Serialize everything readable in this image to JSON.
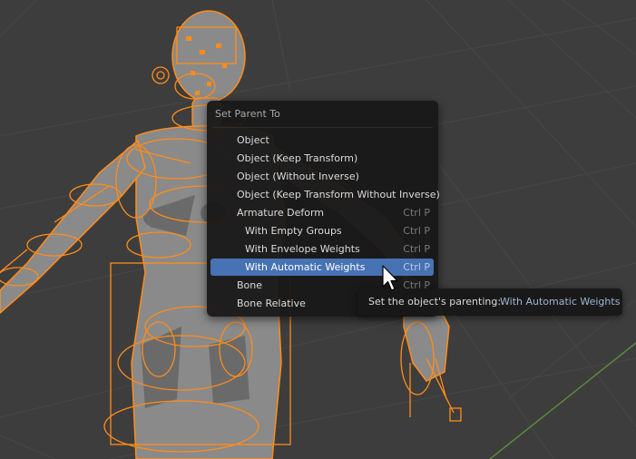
{
  "colors": {
    "viewport_bg": "#3d3d3d",
    "grid_line": "#4a4a4a",
    "armature_orange": "#ff8c1a",
    "mesh_gray": "#8a8a8a",
    "menu_bg": "#181818",
    "highlight": "#4772b3",
    "axis_green": "#5a8a3a"
  },
  "menu": {
    "title": "Set Parent To",
    "items": [
      {
        "label": "Object",
        "shortcut": "",
        "indent": false,
        "active": false
      },
      {
        "label": "Object (Keep Transform)",
        "shortcut": "",
        "indent": false,
        "active": false
      },
      {
        "label": "Object (Without Inverse)",
        "shortcut": "",
        "indent": false,
        "active": false
      },
      {
        "label": "Object (Keep Transform Without Inverse)",
        "shortcut": "",
        "indent": false,
        "active": false
      },
      {
        "label": "Armature Deform",
        "shortcut": "Ctrl P",
        "indent": false,
        "active": false
      },
      {
        "label": "With Empty Groups",
        "shortcut": "Ctrl P",
        "indent": true,
        "active": false
      },
      {
        "label": "With Envelope Weights",
        "shortcut": "Ctrl P",
        "indent": true,
        "active": false
      },
      {
        "label": "With Automatic Weights",
        "shortcut": "Ctrl P",
        "indent": true,
        "active": true
      },
      {
        "label": "Bone",
        "shortcut": "Ctrl P",
        "indent": false,
        "active": false
      },
      {
        "label": "Bone Relative",
        "shortcut": "",
        "indent": false,
        "active": false
      }
    ]
  },
  "tooltip": {
    "label": "Set the object's parenting:",
    "value": "With Automatic Weights"
  },
  "cursor_icon": "arrow-cursor-icon"
}
